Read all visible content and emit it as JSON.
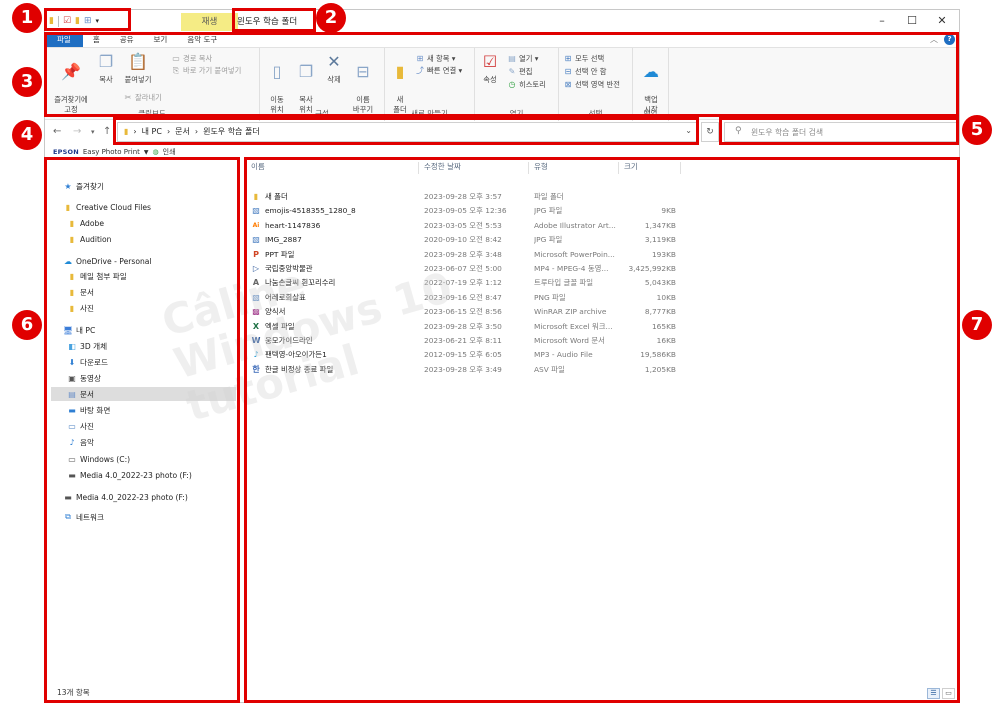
{
  "window": {
    "title": "윈도우 학습 폴더",
    "contextual_tab": "재생",
    "controls": {
      "minimize": "–",
      "maximize": "☐",
      "close": "✕"
    }
  },
  "ribbon_tabs": [
    "파일",
    "홈",
    "공유",
    "보기",
    "음악 도구"
  ],
  "ribbon": {
    "clipboard": {
      "pin": "즐겨찾기에\n고정",
      "copy": "복사",
      "paste": "붙여넣기",
      "copy_path": "경로 복사",
      "paste_shortcut": "바로 가기 붙여넣기",
      "cut": "잘라내기",
      "label": "클립보드"
    },
    "organize": {
      "move_to": "이동\n위치",
      "copy_to": "복사\n위치",
      "delete": "삭제",
      "rename": "이름\n바꾸기",
      "label": "구성"
    },
    "new": {
      "new_folder": "새\n폴더",
      "new_item": "새 항목",
      "easy_access": "빠른 연결",
      "label": "새로 만들기"
    },
    "open": {
      "properties": "속성",
      "open": "열기",
      "edit": "편집",
      "history": "히스토리",
      "label": "열기"
    },
    "select": {
      "select_all": "모두 선택",
      "select_none": "선택 안 함",
      "invert": "선택 영역 반전",
      "label": "선택"
    },
    "backup": {
      "start": "백업\n시작",
      "label": "백업"
    }
  },
  "address": {
    "breadcrumb": [
      "내 PC",
      "문서",
      "윈도우 학습 폴더"
    ],
    "search_placeholder": "윈도우 학습 폴더 검색"
  },
  "epson_bar": {
    "logo": "EPSON",
    "app": "Easy Photo Print",
    "print": "인쇄"
  },
  "nav": {
    "quick_access": "즐겨찾기",
    "creative_cloud": "Creative Cloud Files",
    "cc_items": [
      "Adobe",
      "Audition"
    ],
    "onedrive": "OneDrive - Personal",
    "od_items": [
      "메일 첨부 파일",
      "문서",
      "사진"
    ],
    "this_pc": "내 PC",
    "pc_items": [
      "3D 개체",
      "다운로드",
      "동영상",
      "문서",
      "바탕 화면",
      "사진",
      "음악",
      "Windows (C:)",
      "Media 4.0_2022-23 photo (F:)"
    ],
    "media_drive": "Media 4.0_2022-23 photo (F:)",
    "network": "네트워크",
    "status": "13개 항목"
  },
  "columns": {
    "name": "이름",
    "date": "수정한 날짜",
    "type": "유형",
    "size": "크기"
  },
  "files": [
    {
      "name": "새 폴더",
      "date": "2023-09-28 오후 3:57",
      "type": "파일 폴더",
      "size": "",
      "icon": "folder-icon"
    },
    {
      "name": "emojis-4518355_1280_8",
      "date": "2023-09-05 오후 12:36",
      "type": "JPG 파일",
      "size": "9KB",
      "icon": "image-icon"
    },
    {
      "name": "heart-1147836",
      "date": "2023-03-05 오전 5:53",
      "type": "Adobe Illustrator Art...",
      "size": "1,347KB",
      "icon": "illustrator-icon"
    },
    {
      "name": "IMG_2887",
      "date": "2020-09-10 오전 8:42",
      "type": "JPG 파일",
      "size": "3,119KB",
      "icon": "image-icon"
    },
    {
      "name": "PPT 파일",
      "date": "2023-09-28 오후 3:48",
      "type": "Microsoft PowerPoin...",
      "size": "193KB",
      "icon": "powerpoint-icon"
    },
    {
      "name": "국립중앙박물관",
      "date": "2023-06-07 오전 5:00",
      "type": "MP4 - MPEG-4 동영...",
      "size": "3,425,992KB",
      "icon": "video-icon"
    },
    {
      "name": "나눔손글씨 흰꼬리수리",
      "date": "2022-07-19 오후 1:12",
      "type": "트루타입 글꼴 파일",
      "size": "5,043KB",
      "icon": "font-icon"
    },
    {
      "name": "어레로회살표",
      "date": "2023-09-16 오전 8:47",
      "type": "PNG 파일",
      "size": "10KB",
      "icon": "image-icon"
    },
    {
      "name": "양식서",
      "date": "2023-06-15 오전 8:56",
      "type": "WinRAR ZIP archive",
      "size": "8,777KB",
      "icon": "archive-icon"
    },
    {
      "name": "엑셀 파일",
      "date": "2023-09-28 오후 3:50",
      "type": "Microsoft Excel 워크...",
      "size": "165KB",
      "icon": "excel-icon"
    },
    {
      "name": "웅모가이드라인",
      "date": "2023-06-21 오후 8:11",
      "type": "Microsoft Word 문서",
      "size": "16KB",
      "icon": "word-icon"
    },
    {
      "name": "팬텍영-아오이가든1",
      "date": "2012-09-15 오후 6:05",
      "type": "MP3 - Audio File",
      "size": "19,586KB",
      "icon": "audio-icon"
    },
    {
      "name": "한글 비정상 종료 파일",
      "date": "2023-09-28 오후 3:49",
      "type": "ASV 파일",
      "size": "1,205KB",
      "icon": "hwp-icon"
    }
  ],
  "watermark": "Câline\nWindows 10\ntutorial",
  "annotations": [
    "1",
    "2",
    "3",
    "4",
    "5",
    "6",
    "7"
  ],
  "colors": {
    "accent": "#1f6ec2",
    "annotation": "#e00000",
    "contextual_tab": "#f5ec85"
  }
}
